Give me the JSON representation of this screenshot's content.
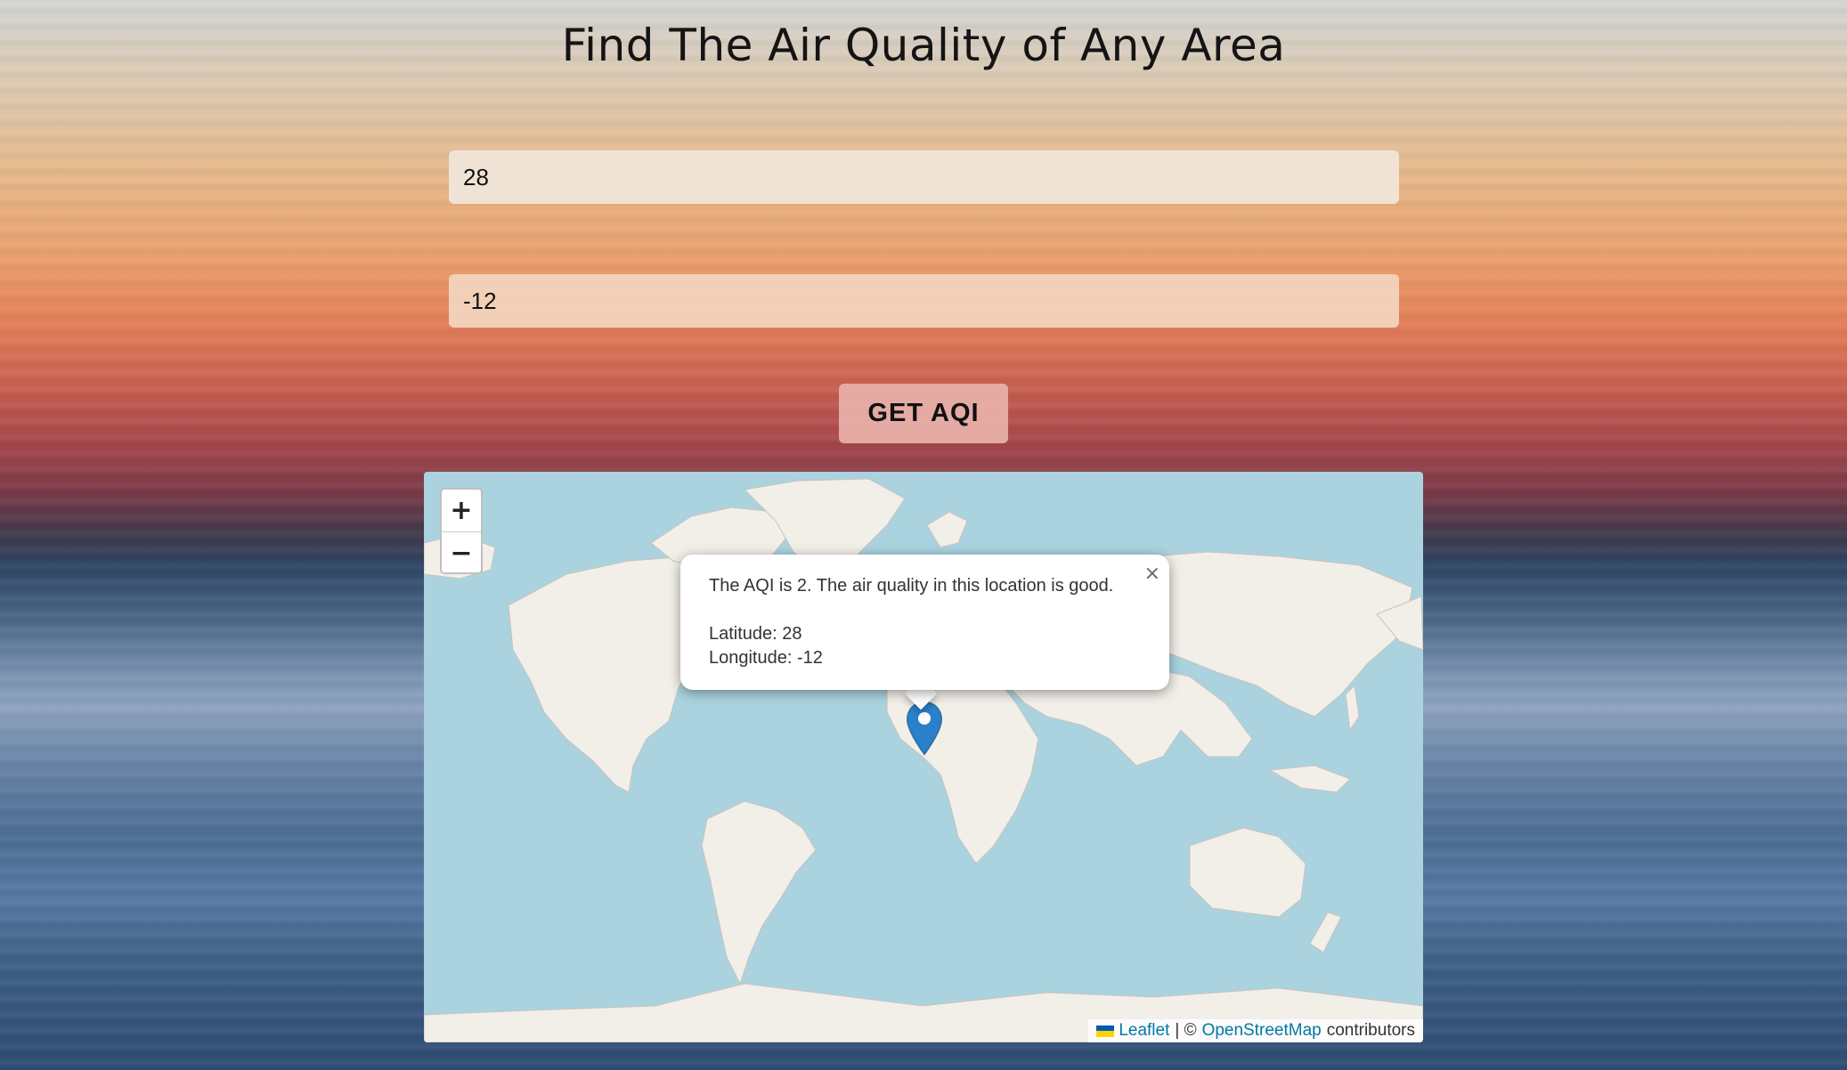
{
  "page": {
    "title": "Find The Air Quality of Any Area"
  },
  "form": {
    "latitude_value": "28",
    "longitude_value": "-12",
    "submit_label": "GET AQI"
  },
  "map": {
    "zoom_in_label": "+",
    "zoom_out_label": "−",
    "popup": {
      "close_label": "×",
      "message": "The AQI is 2. The air quality in this location is good.",
      "latitude_line": "Latitude: 28",
      "longitude_line": "Longitude: -12"
    },
    "attribution": {
      "leaflet_label": "Leaflet",
      "separator": "| ©",
      "osm_label": "OpenStreetMap",
      "suffix": "contributors"
    }
  },
  "colors": {
    "map_water": "#aad3df",
    "map_land": "#f2efe9",
    "marker": "#2a81cb",
    "link": "#0078a8"
  }
}
